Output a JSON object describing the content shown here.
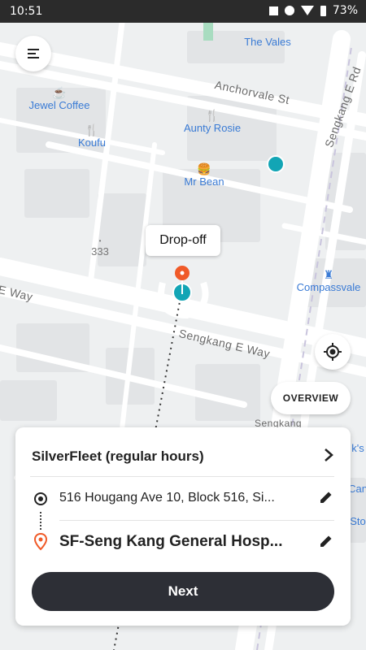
{
  "status_bar": {
    "time": "10:51",
    "battery": "73%"
  },
  "map": {
    "pois": [
      {
        "name": "The Vales",
        "icon": "none"
      },
      {
        "name": "Jewel Coffee",
        "icon": "coffee-cup-icon"
      },
      {
        "name": "Aunty Rosie",
        "icon": "fork-knife-icon"
      },
      {
        "name": "Koufu",
        "icon": "fork-knife-icon"
      },
      {
        "name": "Mr Bean",
        "icon": "burger-icon"
      },
      {
        "name": "333",
        "icon": "dot-icon"
      },
      {
        "name": "Compassvale",
        "icon": "castle-icon"
      }
    ],
    "roads": {
      "anchorvale": "Anchorvale St",
      "sengkang_e_rd": "Sengkang E Rd",
      "sengkang_e_way": "Sengkang E Way",
      "e_way_left": "E Way",
      "sengkang_partial": "Sengkang",
      "edge_ks": "k's",
      "edge_can": "Can",
      "edge_sto": "Sto"
    },
    "dropoff_label": "Drop-off"
  },
  "overview_label": "OVERVIEW",
  "booking": {
    "service": "SilverFleet (regular hours)",
    "pickup": "516 Hougang Ave 10, Block 516, Si...",
    "dropoff": "SF-Seng Kang General Hosp...",
    "next_label": "Next"
  },
  "colors": {
    "accent_teal": "#12a5b5",
    "dropoff_orange": "#f05a28",
    "button_dark": "#2d2f36"
  }
}
